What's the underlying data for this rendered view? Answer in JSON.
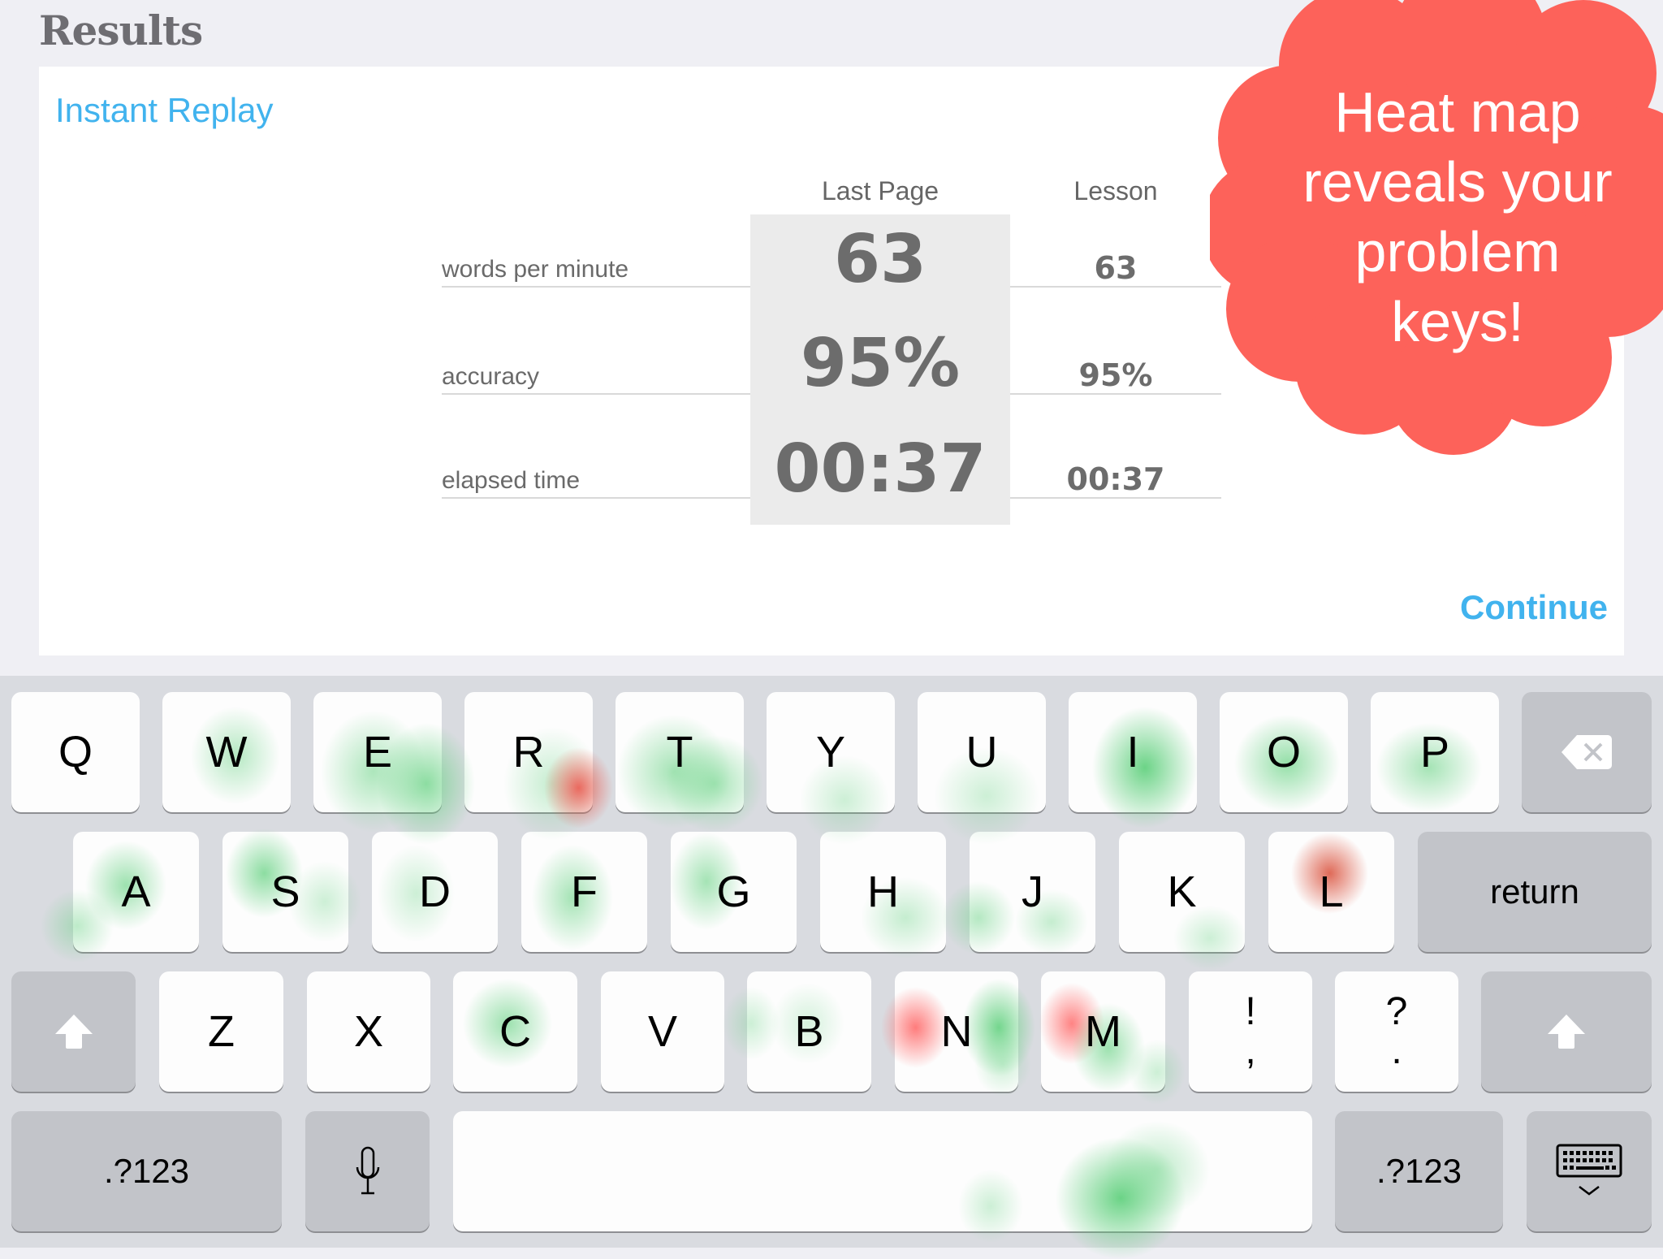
{
  "header": {
    "title": "Results",
    "settings_icon": "gear-icon"
  },
  "panel": {
    "instant_replay": "Instant Replay",
    "continue": "Continue",
    "columns": {
      "last_page": "Last Page",
      "lesson": "Lesson"
    },
    "rows": [
      {
        "label": "words per minute",
        "last_page": "63",
        "lesson": "63"
      },
      {
        "label": "accuracy",
        "last_page": "95%",
        "lesson": "95%"
      },
      {
        "label": "elapsed time",
        "last_page": "00:37",
        "lesson": "00:37"
      }
    ]
  },
  "callout": {
    "lines": [
      "Heat map",
      "reveals your",
      "problem",
      "keys!"
    ],
    "color": "#fd625a"
  },
  "colors": {
    "accent": "#41b3ee",
    "heat_good": "#5ccf7a",
    "heat_bad": "#f25b5b"
  },
  "keyboard": {
    "row1": [
      "Q",
      "W",
      "E",
      "R",
      "T",
      "Y",
      "U",
      "I",
      "O",
      "P"
    ],
    "row2": [
      "A",
      "S",
      "D",
      "F",
      "G",
      "H",
      "J",
      "K",
      "L"
    ],
    "row3": [
      "Z",
      "X",
      "C",
      "V",
      "B",
      "N",
      "M"
    ],
    "punct1": {
      "top": "!",
      "bottom": ","
    },
    "punct2": {
      "top": "?",
      "bottom": "."
    },
    "return": "return",
    "numbers": ".?123",
    "delete_icon": "backspace-icon",
    "shift_icon": "shift-icon",
    "mic_icon": "microphone-icon",
    "dismiss_icon": "keyboard-dismiss-icon"
  },
  "heatmap": {
    "problem_keys": [
      "R",
      "L",
      "N",
      "M"
    ],
    "hot_keys": [
      "E",
      "T",
      "I",
      "O",
      "P",
      "S",
      "A",
      "C",
      "space"
    ]
  }
}
